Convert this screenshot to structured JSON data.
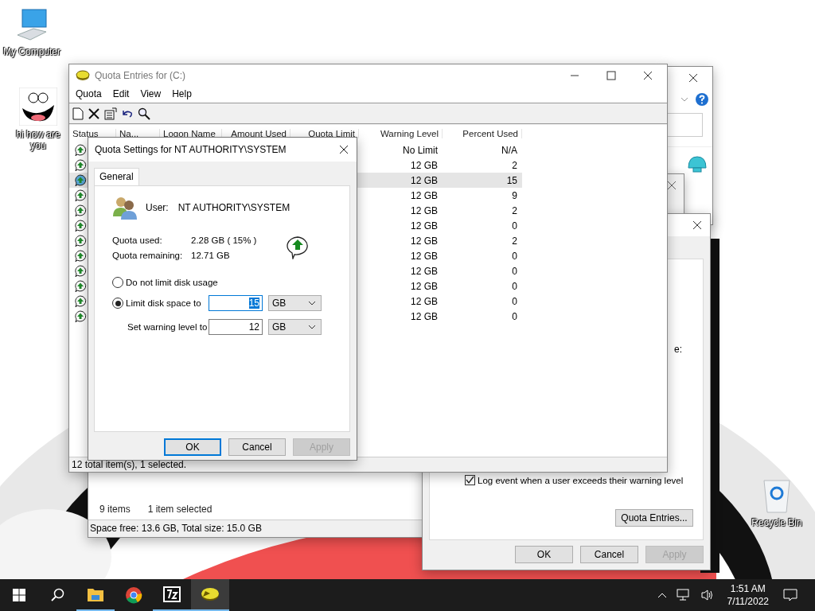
{
  "desktop_icons": [
    {
      "label": "My Computer",
      "kind": "computer"
    },
    {
      "label": "hi how are you",
      "kind": "face"
    },
    {
      "label": "Recycle Bin",
      "kind": "recycle"
    }
  ],
  "explorer_window": {
    "item_count": "9 items",
    "selection": "1 item selected",
    "status": "Space free: 13.6 GB, Total size: 15.0 GB"
  },
  "properties_dialog": {
    "label_fragment": "e:",
    "log_warning": {
      "label": "Log event when a user exceeds their warning level",
      "checked": true
    },
    "quota_entries_button": "Quota Entries...",
    "buttons": [
      {
        "label": "OK",
        "disabled": false
      },
      {
        "label": "Cancel",
        "disabled": false
      },
      {
        "label": "Apply",
        "disabled": true
      }
    ]
  },
  "quota_window": {
    "title": "Quota Entries for  (C:)",
    "menu": [
      "Quota",
      "Edit",
      "View",
      "Help"
    ],
    "toolbar": [
      {
        "kind": "new"
      },
      {
        "kind": "delete"
      },
      {
        "kind": "properties"
      },
      {
        "kind": "undo"
      },
      {
        "kind": "find"
      }
    ],
    "columns": [
      "Status",
      "Na...",
      "Logon Name",
      "Amount Used",
      "Quota Limit",
      "Warning Level",
      "Percent Used"
    ],
    "rows": [
      {
        "warning_level": "No Limit",
        "percent_used": "N/A",
        "selected": false
      },
      {
        "warning_level": "12 GB",
        "percent_used": "2",
        "selected": false
      },
      {
        "warning_level": "12 GB",
        "percent_used": "15",
        "selected": true
      },
      {
        "warning_level": "12 GB",
        "percent_used": "9",
        "selected": false
      },
      {
        "warning_level": "12 GB",
        "percent_used": "2",
        "selected": false
      },
      {
        "warning_level": "12 GB",
        "percent_used": "0",
        "selected": false
      },
      {
        "warning_level": "12 GB",
        "percent_used": "2",
        "selected": false
      },
      {
        "warning_level": "12 GB",
        "percent_used": "0",
        "selected": false
      },
      {
        "warning_level": "12 GB",
        "percent_used": "0",
        "selected": false
      },
      {
        "warning_level": "12 GB",
        "percent_used": "0",
        "selected": false
      },
      {
        "warning_level": "12 GB",
        "percent_used": "0",
        "selected": false
      },
      {
        "warning_level": "12 GB",
        "percent_used": "0",
        "selected": false
      }
    ],
    "status_bar": "12 total item(s), 1 selected."
  },
  "settings_dialog": {
    "title": "Quota Settings for NT AUTHORITY\\SYSTEM",
    "tabs": [
      {
        "label": "General",
        "selected": true
      }
    ],
    "user_label": "User:",
    "user": "NT AUTHORITY\\SYSTEM",
    "quota_used_label": "Quota used:",
    "quota_used": "2.28 GB ( 15% )",
    "quota_remaining_label": "Quota remaining:",
    "quota_remaining": "12.71 GB",
    "options": [
      {
        "label": "Do not limit disk usage",
        "selected": false
      },
      {
        "label": "Limit disk space to",
        "selected": true
      }
    ],
    "limit_value": "15",
    "limit_unit": "GB",
    "warning_label": "Set warning level to",
    "warning_value": "12",
    "warning_unit": "GB",
    "buttons": [
      {
        "label": "OK",
        "disabled": false
      },
      {
        "label": "Cancel",
        "disabled": false
      },
      {
        "label": "Apply",
        "disabled": true
      }
    ]
  },
  "taskbar": {
    "apps": [
      {
        "kind": "explorer",
        "running": true,
        "active": false
      },
      {
        "kind": "chrome",
        "running": false,
        "active": false
      },
      {
        "kind": "sevenzip",
        "running": true,
        "active": false
      },
      {
        "kind": "quota",
        "running": true,
        "active": true
      }
    ],
    "time": "1:51 AM",
    "date": "7/11/2022"
  }
}
